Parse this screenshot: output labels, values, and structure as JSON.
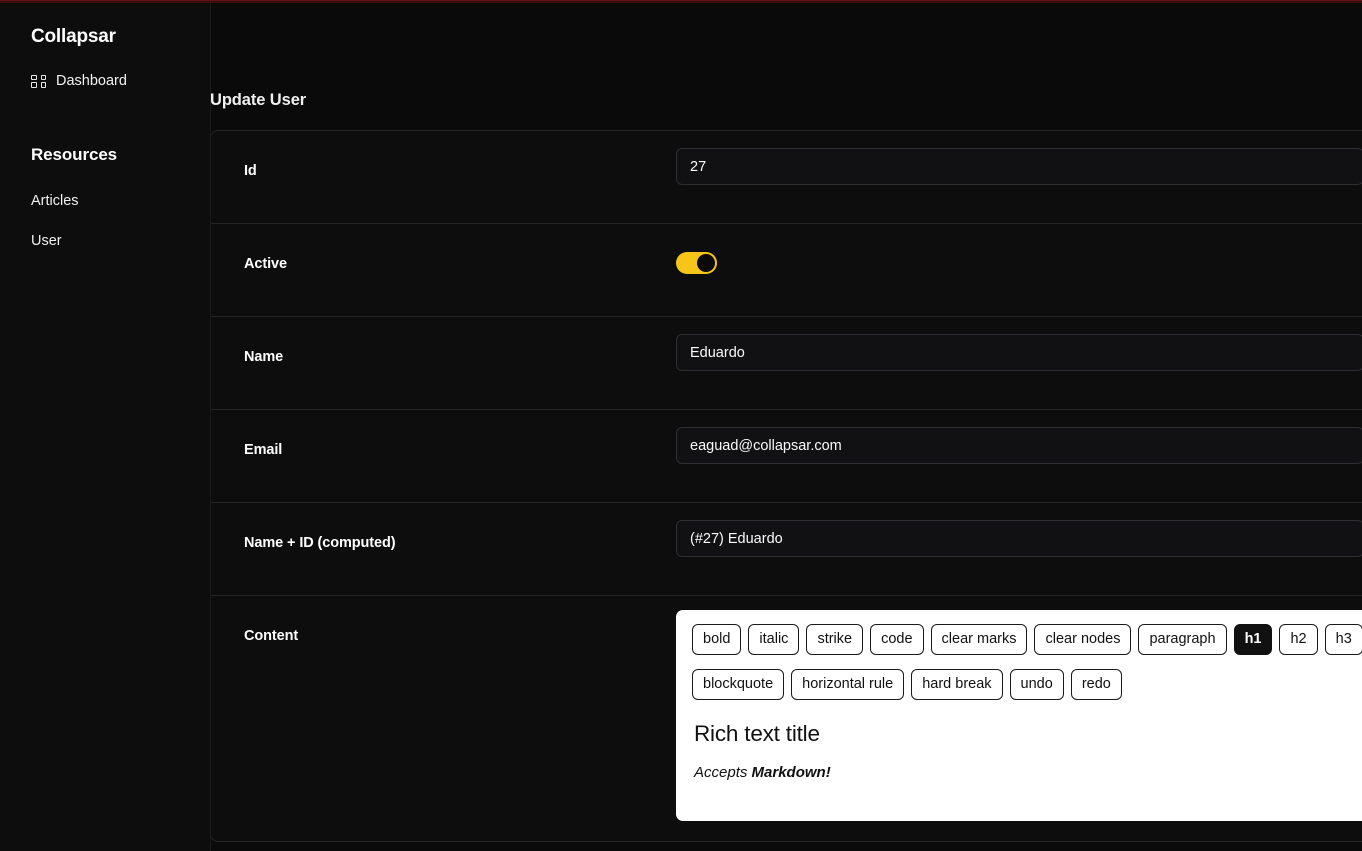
{
  "app": {
    "brand": "Collapsar",
    "accent_color": "#f6c518",
    "background_color": "#0a0a0a",
    "sidebar_color": "#0d0d0d"
  },
  "sidebar": {
    "brand": "Collapsar",
    "dashboard": {
      "label": "Dashboard",
      "icon": "grid-icon"
    },
    "section_title": "Resources",
    "links": [
      {
        "label": "Articles"
      },
      {
        "label": "User"
      }
    ]
  },
  "main": {
    "page_title": "Update User",
    "fields": {
      "id": {
        "label": "Id",
        "value": "27",
        "placeholder": ""
      },
      "active": {
        "label": "Active",
        "value": "on"
      },
      "name": {
        "label": "Name",
        "value": "Eduardo",
        "placeholder": ""
      },
      "email": {
        "label": "Email",
        "value": "eaguad@collapsar.com",
        "placeholder": ""
      },
      "computed": {
        "label": "Name + ID (computed)",
        "value": "(#27) Eduardo",
        "placeholder": ""
      },
      "content": {
        "label": "Content"
      }
    }
  },
  "editor": {
    "toolbar_row_1": [
      {
        "label": "bold",
        "active": false
      },
      {
        "label": "italic",
        "active": false
      },
      {
        "label": "strike",
        "active": false
      },
      {
        "label": "code",
        "active": false
      },
      {
        "label": "clear marks",
        "active": false
      },
      {
        "label": "clear nodes",
        "active": false
      },
      {
        "label": "paragraph",
        "active": false
      },
      {
        "label": "h1",
        "active": true
      },
      {
        "label": "h2",
        "active": false
      },
      {
        "label": "h3",
        "active": false
      }
    ],
    "toolbar_row_2": [
      {
        "label": "blockquote",
        "active": false
      },
      {
        "label": "horizontal rule",
        "active": false
      },
      {
        "label": "hard break",
        "active": false
      },
      {
        "label": "undo",
        "active": false
      },
      {
        "label": "redo",
        "active": false
      }
    ],
    "content": {
      "heading": "Rich text title",
      "paragraph_prefix": "Accepts ",
      "paragraph_bold": "Markdown!"
    }
  }
}
